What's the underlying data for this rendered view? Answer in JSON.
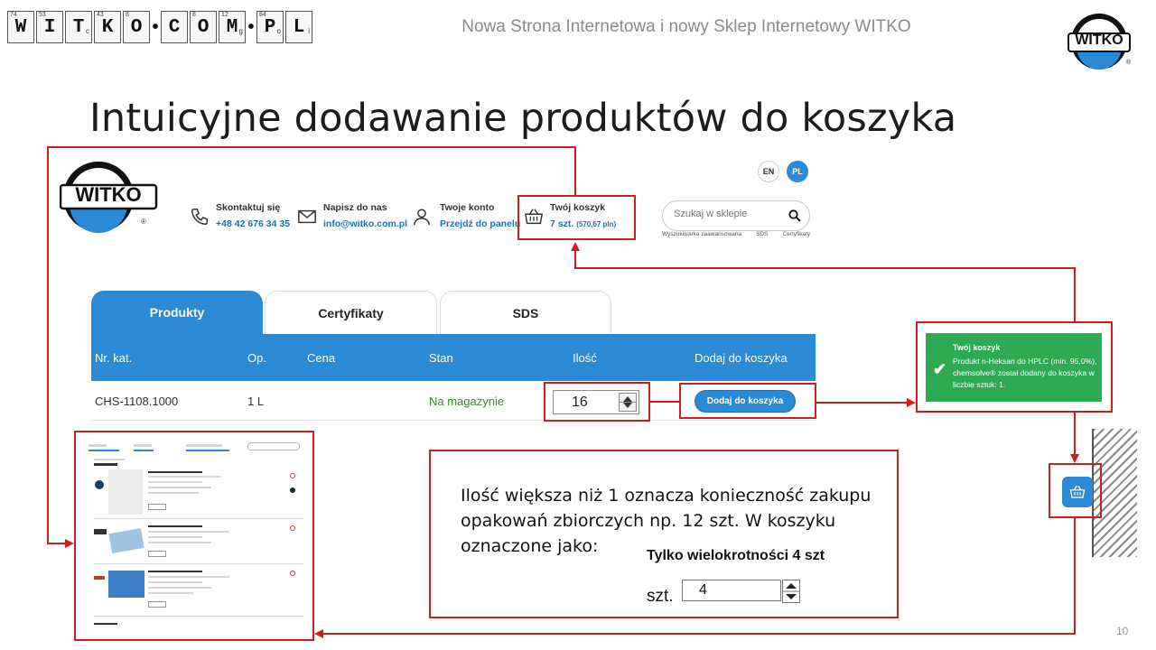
{
  "brand_logo": {
    "elements": [
      {
        "num": "74",
        "sym": "W",
        "sub": ""
      },
      {
        "num": "53",
        "sym": "I",
        "sub": ""
      },
      {
        "num": "",
        "sym": "T",
        "sub": "c"
      },
      {
        "num": "43",
        "sym": "K",
        "sub": ""
      },
      {
        "num": "8",
        "sym": "O",
        "sub": ""
      },
      {
        "num": "",
        "sym": "C",
        "sub": ""
      },
      {
        "num": "8",
        "sym": "O",
        "sub": ""
      },
      {
        "num": "12",
        "sym": "M",
        "sub": "g"
      },
      {
        "num": "84",
        "sym": "P",
        "sub": "o"
      },
      {
        "num": "",
        "sym": "L",
        "sub": "i"
      }
    ]
  },
  "header": {
    "title": "Nowa Strona Internetowa i nowy Sklep Internetowy WITKO",
    "logo_text": "WITKO",
    "reg_mark": "®"
  },
  "slide": {
    "heading": "Intuicyjne dodawanie produktów do koszyka",
    "page_number": "10"
  },
  "site": {
    "logo_text": "WITKO",
    "reg_mark": "®",
    "languages": [
      "EN",
      "PL"
    ],
    "contact": {
      "label": "Skontaktuj się",
      "value": "+48 42 676 34 35"
    },
    "email": {
      "label": "Napisz do nas",
      "value": "info@witko.com.pl"
    },
    "account": {
      "label": "Twoje konto",
      "value": "Przejdź do panelu"
    },
    "cart": {
      "label": "Twój koszyk",
      "value": "7 szt.",
      "amount": "(570,67 pln)"
    },
    "search": {
      "placeholder": "Szukaj w sklepie",
      "links": [
        "Wyszukiwarka zaawansowana",
        "SDS",
        "Certyfikaty"
      ]
    },
    "tabs": [
      "Produkty",
      "Certyfikaty",
      "SDS"
    ],
    "table": {
      "headers": [
        "Nr. kat.",
        "Op.",
        "Cena",
        "Stan",
        "Ilość",
        "Dodaj do koszyka"
      ],
      "row": {
        "cat_no": "CHS-1108.1000",
        "pack": "1 L",
        "price": "",
        "stock": "Na magazynie",
        "qty": "16",
        "add_label": "Dodaj do koszyka"
      }
    }
  },
  "notification": {
    "title": "Twój koszyk",
    "message": "Produkt n-Heksan do HPLC (min. 95,0%), chemsolve® został dodany do koszyka w liczbie sztuk: 1."
  },
  "info": {
    "text": "Ilość większa niż 1 oznacza konieczność zakupu opakowań zbiorczych np. 12 szt. W koszyku oznaczone jako:",
    "multiple_label": "Tylko wielokrotności 4 szt",
    "unit": "szt.",
    "value": "4"
  },
  "colors": {
    "accent_blue": "#2b8ad6",
    "frame_red": "#d01c1c",
    "success_green": "#2eab52"
  },
  "icons": [
    "phone-icon",
    "mail-icon",
    "user-icon",
    "basket-icon",
    "search-icon",
    "check-icon"
  ]
}
